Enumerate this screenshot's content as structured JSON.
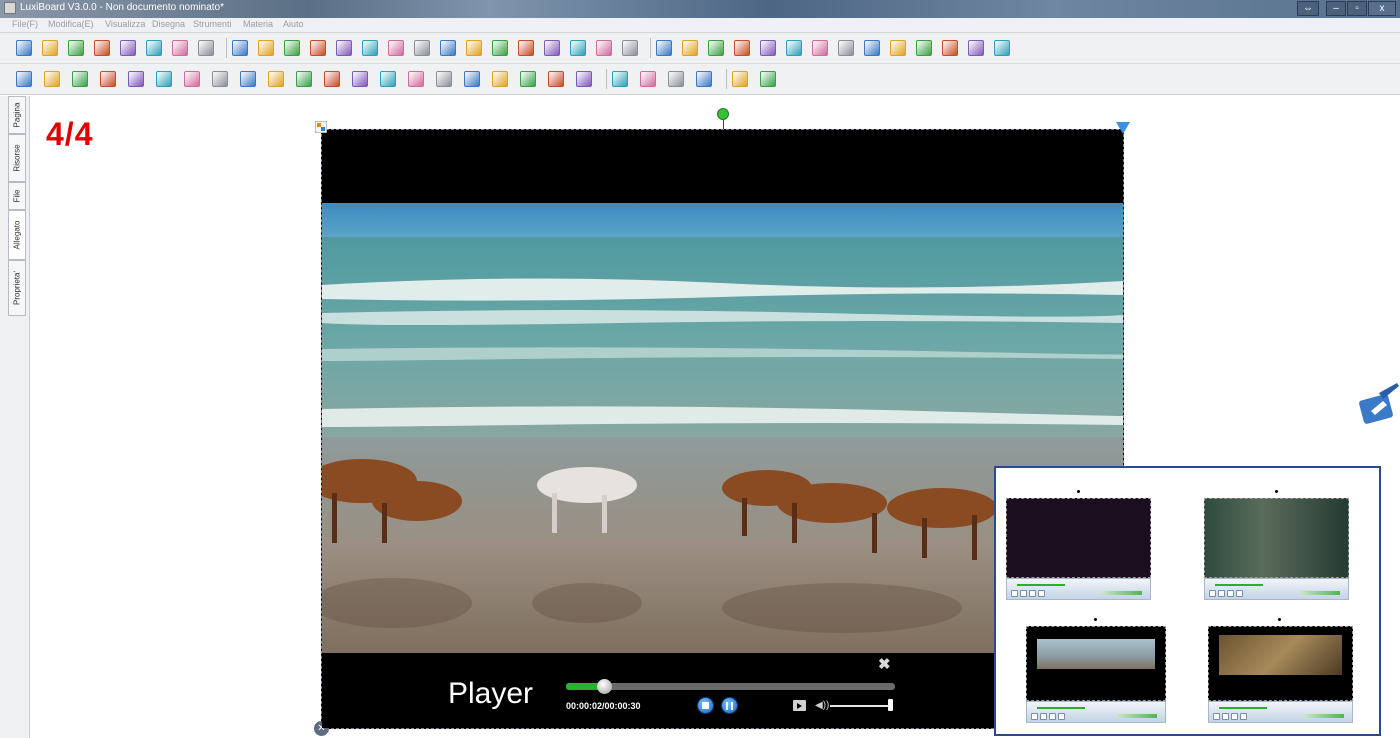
{
  "window": {
    "title": "LuxiBoard V3.0.0 - Non documento nominato*"
  },
  "menu": [
    "File(F)",
    "Modifica(E)",
    "Visualizza",
    "Disegna",
    "Strumenti",
    "Materia",
    "Aiuto"
  ],
  "toolbar1_icons": [
    "new-page-icon",
    "import-icon",
    "export-icon",
    "open-folder-icon",
    "save-icon",
    "save-as-icon",
    "email-icon",
    "share-icon",
    "undo-icon",
    "redo-icon",
    "cut-icon",
    "copy-icon",
    "paste-icon",
    "paste-special-icon",
    "delete-icon",
    "clone-icon",
    "group-icon",
    "zoom-out-icon",
    "zoom-in-icon",
    "bring-forward-icon",
    "send-backward-icon",
    "bring-to-front-icon",
    "send-to-back-icon",
    "screen-capture-icon",
    "curtain-icon",
    "spotlight-icon",
    "camera-icon",
    "pen-highlight-icon",
    "screen-record-icon",
    "magnifier-tool-icon",
    "stopwatch-icon",
    "clock-icon",
    "dice-icon",
    "calculator-icon",
    "globe-icon",
    "keyboard-icon",
    "pointer-hand-icon",
    "handwriting-icon"
  ],
  "toolbar2_icons": [
    "select-arrow-icon",
    "pencil-icon",
    "line-icon",
    "brush-icon",
    "marker-icon",
    "calligraphy-pen-icon",
    "pen-icon",
    "highlighter-icon",
    "lasso-icon",
    "fill-bucket-icon",
    "table-icon",
    "rectangle-icon",
    "shapes-icon",
    "triangle-ruler-icon",
    "set-square-icon",
    "protractor-icon",
    "compass-icon",
    "ruler-icon",
    "pen-tool-icon",
    "plus-axis-icon",
    "sqrt-formula-icon",
    "chart-icon",
    "connector-icon",
    "text-box-icon",
    "align-icon",
    "bar-graph-icon",
    "axis-icon"
  ],
  "side_tabs": [
    "Pagina",
    "Risorse",
    "File",
    "Allegato",
    "Proprieta'"
  ],
  "page_indicator": "4/4",
  "player": {
    "label": "Player",
    "time": "00:00:02/00:00:30",
    "progress_pct": 10,
    "volume_pct": 94
  },
  "colors": {
    "page_indicator": "#e00000",
    "seek_fill": "#2ab02a",
    "panel_border": "#2b4a8c"
  }
}
